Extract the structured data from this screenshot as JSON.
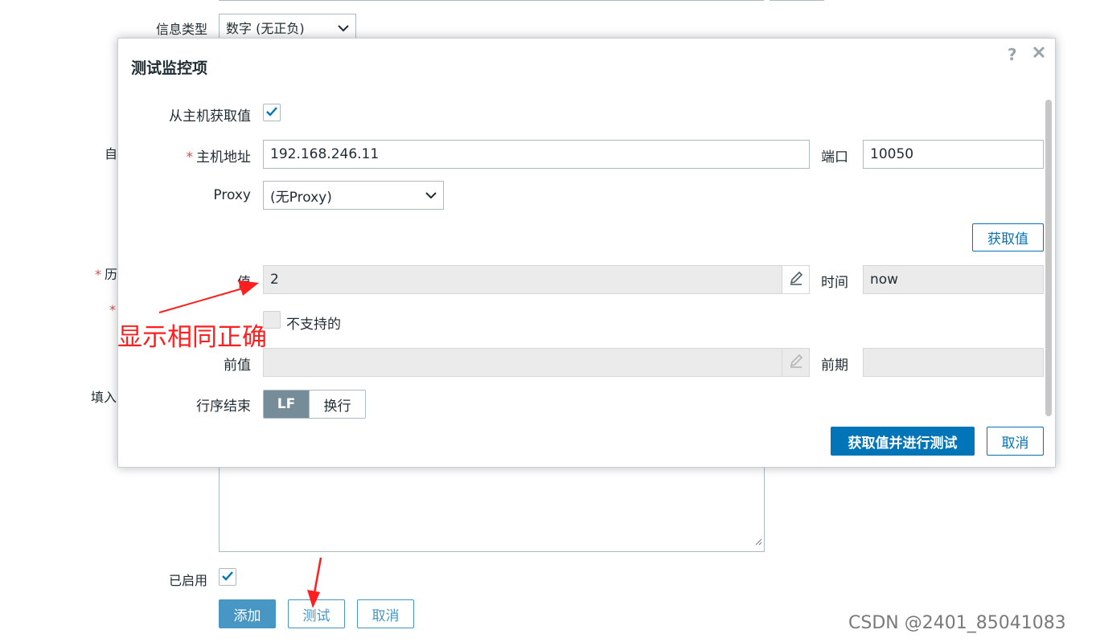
{
  "background_form": {
    "info_type_label": "信息类型",
    "info_type_value": "数字 (无正负)",
    "partial_label_1": "自",
    "partial_label_2": "历",
    "partial_label_4": "填入",
    "enabled_label": "已启用",
    "enabled_checked": true,
    "add_button": "添加",
    "test_button": "测试",
    "cancel_button": "取消"
  },
  "dialog": {
    "title": "测试监控项",
    "help_icon": "question-mark",
    "close_icon": "close-x",
    "get_value_from_host_label": "从主机获取值",
    "get_value_from_host_checked": true,
    "host_address_label": "主机地址",
    "host_address_value": "192.168.246.11",
    "port_label": "端口",
    "port_value": "10050",
    "proxy_label": "Proxy",
    "proxy_value": "(无Proxy)",
    "get_value_button": "获取值",
    "value_label": "值",
    "value_value": "2",
    "time_label": "时间",
    "time_value": "now",
    "not_supported_label": "不支持的",
    "not_supported_checked": false,
    "prev_value_label": "前值",
    "prev_value_value": "",
    "prev_time_label": "前期",
    "prev_time_value": "",
    "eol_label": "行序结束",
    "eol_options": [
      "LF",
      "换行"
    ],
    "eol_selected": "LF",
    "get_and_test_button": "获取值并进行测试",
    "cancel_button": "取消"
  },
  "annotation": {
    "text": "显示相同正确",
    "color": "#ff1f1f"
  },
  "watermark": "CSDN @2401_85041083",
  "colors": {
    "primary": "#0275b8",
    "text": "#1f2c33",
    "readonly_bg": "#ebebeb",
    "required_star": "#d64e4e"
  }
}
